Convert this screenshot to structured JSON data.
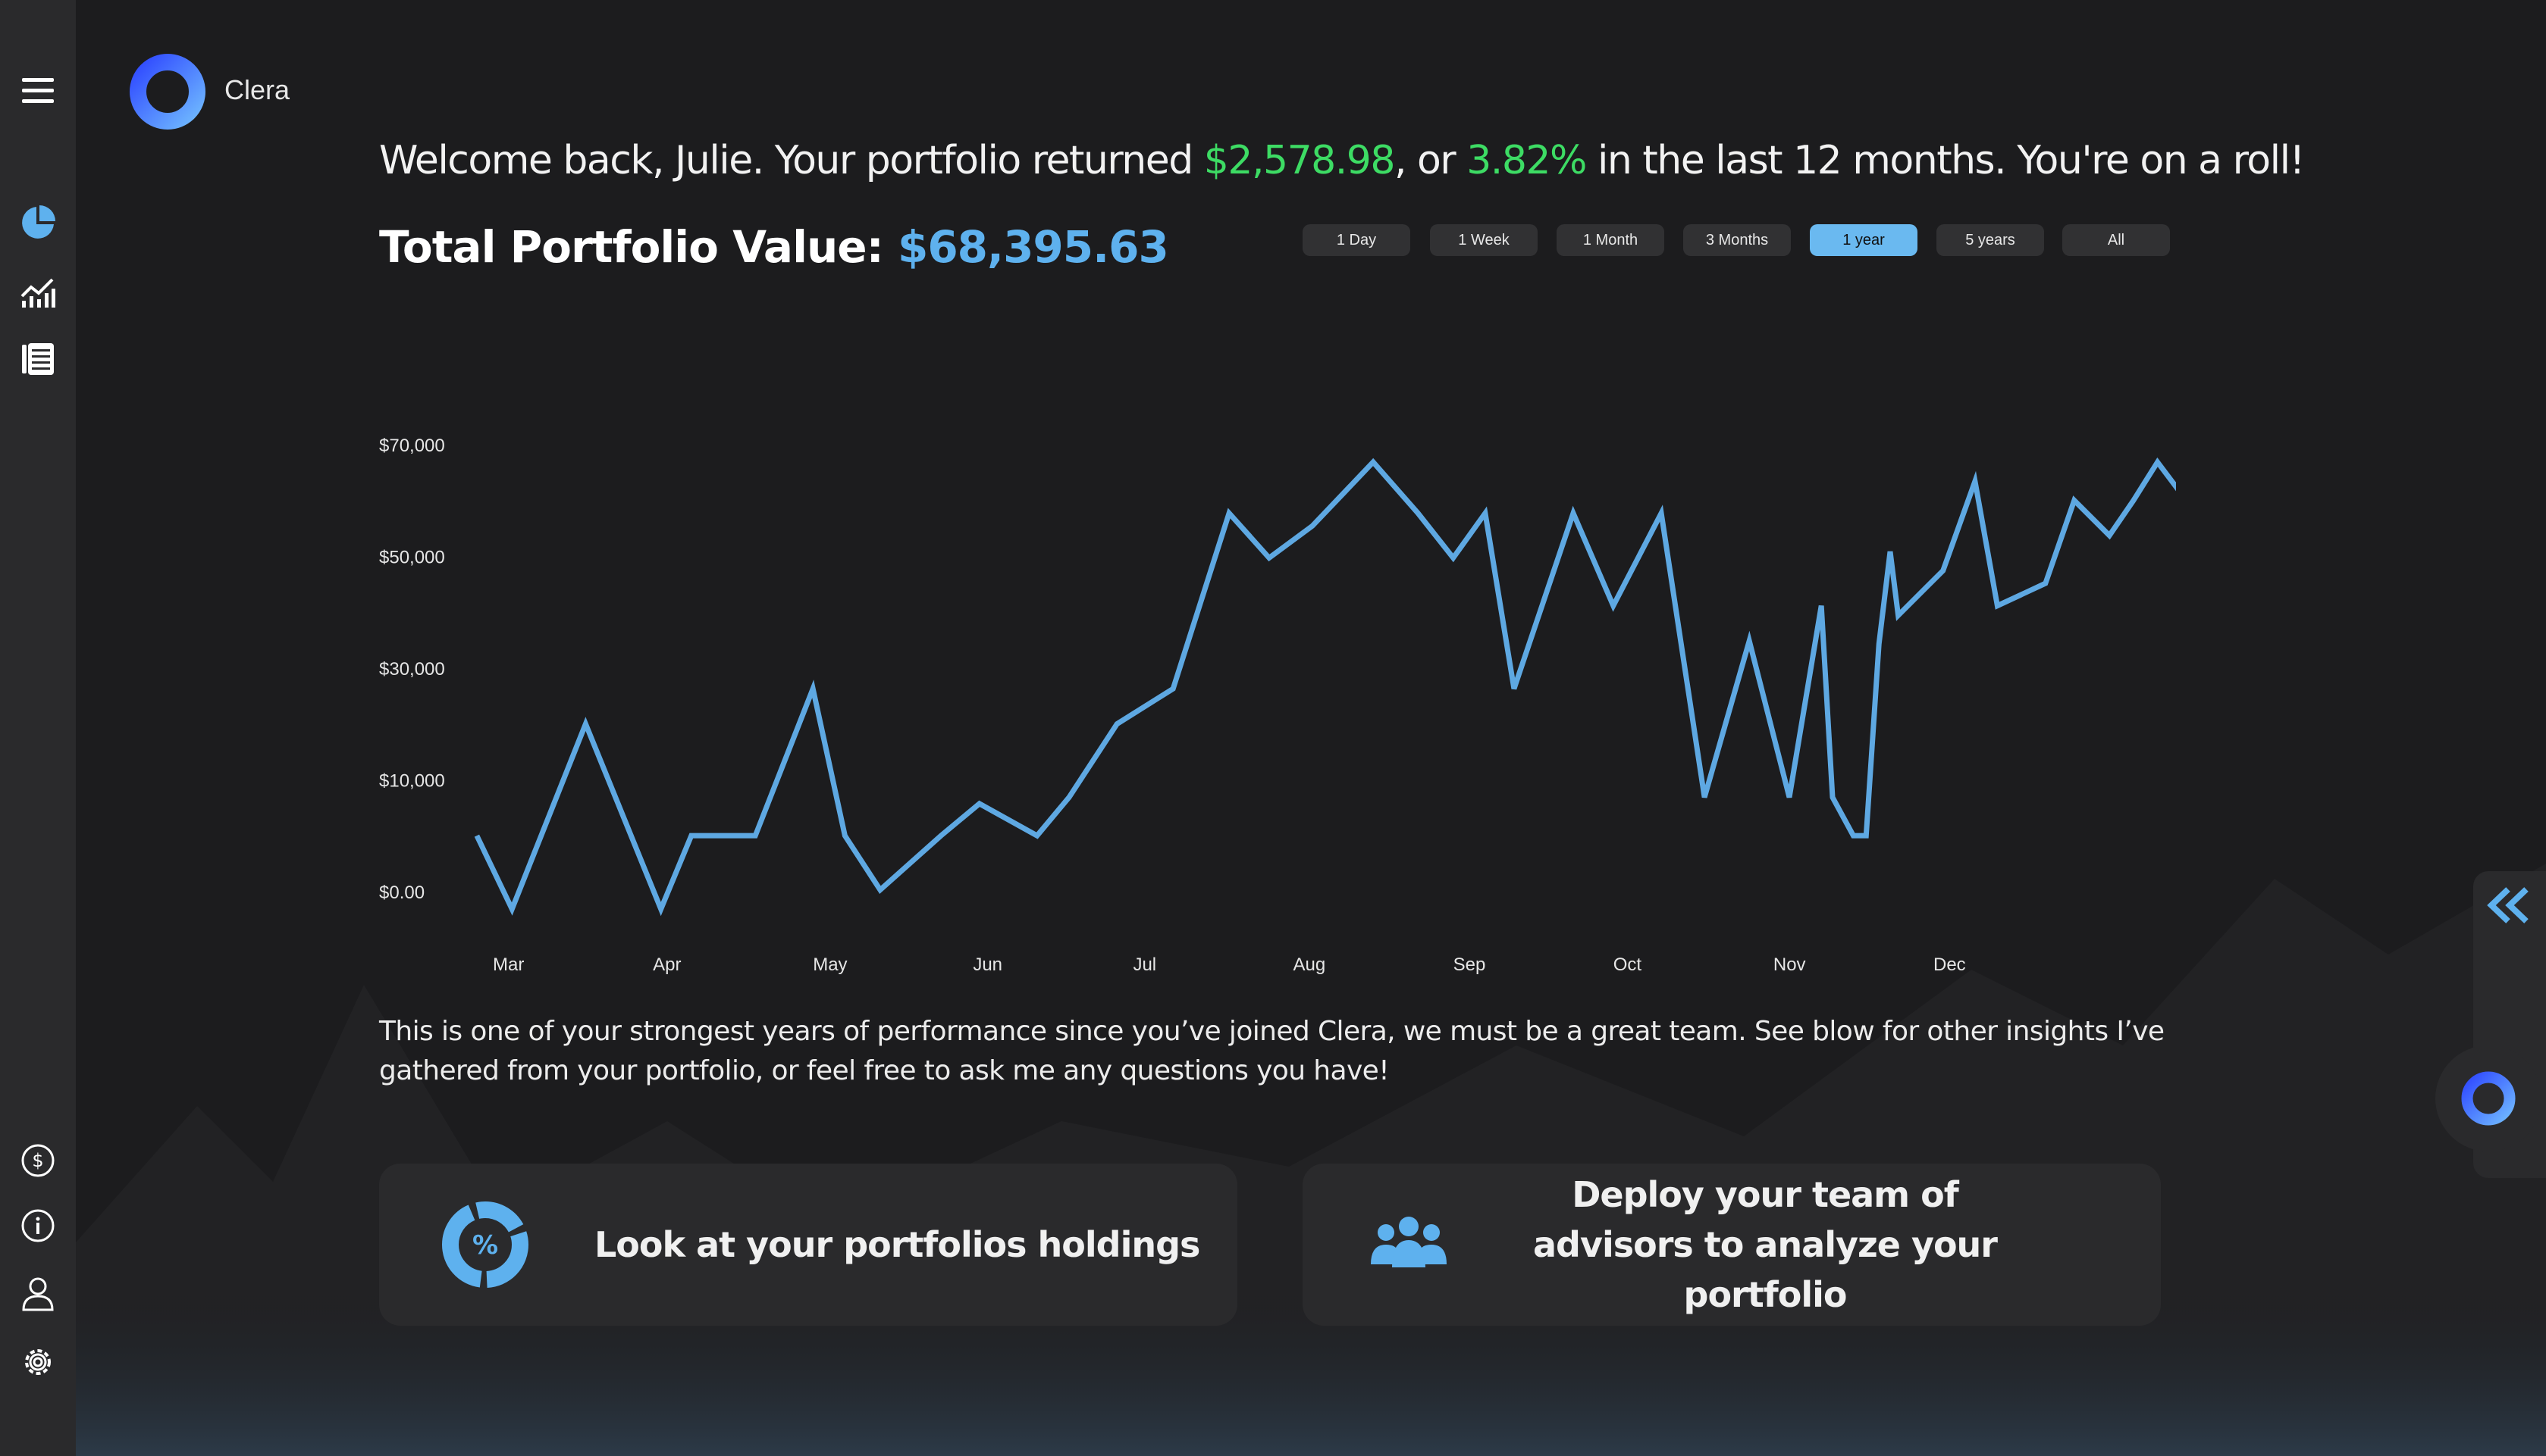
{
  "brand": {
    "name": "Clera"
  },
  "header": {
    "welcome_prefix": "Welcome back, Julie. Your portfolio returned ",
    "return_amount": "$2,578.98",
    "welcome_mid": ", or ",
    "return_percent": "3.82%",
    "welcome_suffix": " in the last 12 months. You're on a roll!",
    "total_label": "Total Portfolio Value: ",
    "total_value": "$68,395.63"
  },
  "ranges": [
    {
      "label": "1 Day",
      "active": false
    },
    {
      "label": "1 Week",
      "active": false
    },
    {
      "label": "1 Month",
      "active": false
    },
    {
      "label": "3 Months",
      "active": false
    },
    {
      "label": "1 year",
      "active": true
    },
    {
      "label": "5 years",
      "active": false
    },
    {
      "label": "All",
      "active": false
    }
  ],
  "chart_data": {
    "type": "line",
    "title": "",
    "xlabel": "",
    "ylabel": "",
    "x_ticks": [
      "Mar",
      "Apr",
      "May",
      "Jun",
      "Jul",
      "Aug",
      "Sep",
      "Oct",
      "Nov",
      "Dec"
    ],
    "y_ticks": [
      "$70,000",
      "$50,000",
      "$30,000",
      "$10,000",
      "$0.00"
    ],
    "ylim": [
      0,
      70000
    ],
    "xlim": [
      0,
      10.35
    ],
    "grid": false,
    "legend": "none",
    "line_color": "#5ea8e2",
    "x": [
      -0.1,
      0.12,
      0.58,
      1.05,
      1.24,
      1.64,
      2.0,
      2.2,
      2.42,
      2.8,
      3.04,
      3.4,
      3.6,
      3.9,
      4.25,
      4.6,
      4.85,
      5.12,
      5.5,
      5.78,
      6.0,
      6.2,
      6.38,
      6.75,
      7.0,
      7.3,
      7.57,
      7.85,
      8.1,
      8.3,
      8.37,
      8.5,
      8.58,
      8.66,
      8.73,
      8.78,
      9.06,
      9.26,
      9.4,
      9.7,
      9.88,
      10.1,
      10.25,
      10.4,
      10.55,
      10.65,
      10.73
    ],
    "y": [
      11500,
      0,
      29000,
      0,
      11500,
      11500,
      34500,
      11500,
      3000,
      11500,
      16500,
      11500,
      17500,
      29000,
      34500,
      62000,
      55000,
      60000,
      70000,
      62000,
      55000,
      62000,
      34500,
      62000,
      47500,
      62000,
      17500,
      42000,
      17500,
      47500,
      17500,
      11500,
      11500,
      41500,
      56000,
      46000,
      53000,
      67000,
      47500,
      51000,
      64000,
      58500,
      64000,
      70000,
      65000,
      72000,
      64500
    ]
  },
  "insight_text": "This is one of your strongest years of performance since you’ve joined Clera, we must be a great team. See blow for other insights I’ve gathered from your portfolio, or feel free to ask me any questions you have!",
  "cards": {
    "holdings": "Look at your portfolios holdings",
    "advisors": "Deploy your team of advisors to analyze your portfolio"
  },
  "colors": {
    "accent_blue": "#5eb1ee",
    "positive_green": "#3ddc64",
    "active_range": "#6ab9f0"
  },
  "icons": {
    "sidebar_top": [
      "menu-icon"
    ],
    "sidebar_nav": [
      "pie-chart-icon",
      "analytics-icon",
      "news-icon"
    ],
    "sidebar_bottom": [
      "dollar-icon",
      "info-icon",
      "user-icon",
      "settings-icon"
    ]
  }
}
